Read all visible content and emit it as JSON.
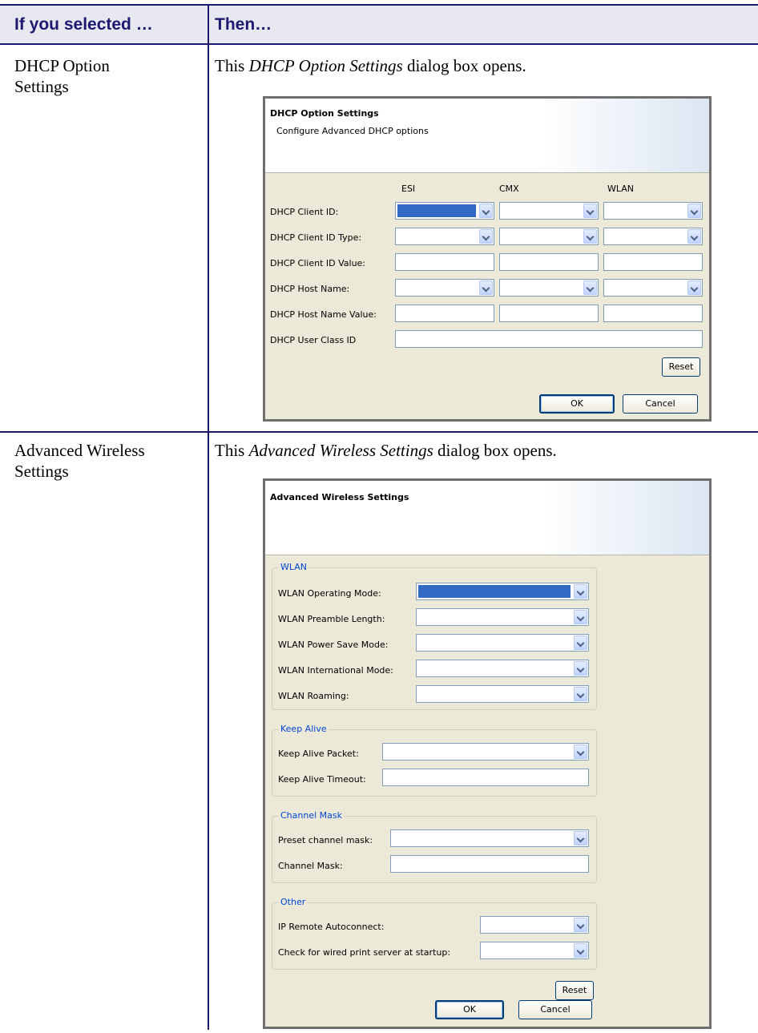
{
  "table": {
    "header_left": "If you selected …",
    "header_right": "Then…",
    "rows": [
      {
        "selected": [
          "DHCP Option",
          "Settings"
        ],
        "then_prefix": "This ",
        "then_italic": "DHCP Option Settings",
        "then_suffix": " dialog box opens."
      },
      {
        "selected": [
          "Advanced Wireless",
          "Settings"
        ],
        "then_prefix": "This ",
        "then_italic": "Advanced Wireless Settings",
        "then_suffix": " dialog box opens."
      }
    ]
  },
  "dhcp_dialog": {
    "title": "DHCP Option Settings",
    "subtitle": "Configure Advanced DHCP options",
    "columns": [
      "ESI",
      "CMX",
      "WLAN"
    ],
    "rows": [
      {
        "label": "DHCP Client ID:",
        "type": "combo"
      },
      {
        "label": "DHCP Client ID Type:",
        "type": "combo"
      },
      {
        "label": "DHCP Client ID Value:",
        "type": "text"
      },
      {
        "label": "DHCP Host Name:",
        "type": "combo"
      },
      {
        "label": "DHCP Host Name Value:",
        "type": "text"
      },
      {
        "label": "DHCP User Class ID",
        "type": "wide-text"
      }
    ],
    "reset_label": "Reset",
    "ok_label": "OK",
    "cancel_label": "Cancel",
    "selected_color": "#316ac5"
  },
  "wireless_dialog": {
    "title": "Advanced Wireless Settings",
    "groups": [
      {
        "name": "WLAN",
        "fields": [
          {
            "label": "WLAN Operating Mode:",
            "type": "combo"
          },
          {
            "label": "WLAN Preamble Length:",
            "type": "combo"
          },
          {
            "label": "WLAN Power Save Mode:",
            "type": "combo"
          },
          {
            "label": "WLAN International Mode:",
            "type": "combo"
          },
          {
            "label": "WLAN Roaming:",
            "type": "combo"
          }
        ]
      },
      {
        "name": "Keep Alive",
        "fields": [
          {
            "label": "Keep Alive Packet:",
            "type": "combo"
          },
          {
            "label": "Keep Alive Timeout:",
            "type": "text"
          }
        ]
      },
      {
        "name": "Channel Mask",
        "fields": [
          {
            "label": "Preset channel mask:",
            "type": "combo"
          },
          {
            "label": "Channel Mask:",
            "type": "text"
          }
        ]
      },
      {
        "name": "Other",
        "fields": [
          {
            "label": "IP Remote Autoconnect:",
            "type": "combo"
          },
          {
            "label": "Check for wired print server at startup:",
            "type": "combo"
          }
        ]
      }
    ],
    "reset_label": "Reset",
    "ok_label": "OK",
    "cancel_label": "Cancel",
    "selected_color": "#316ac5"
  }
}
